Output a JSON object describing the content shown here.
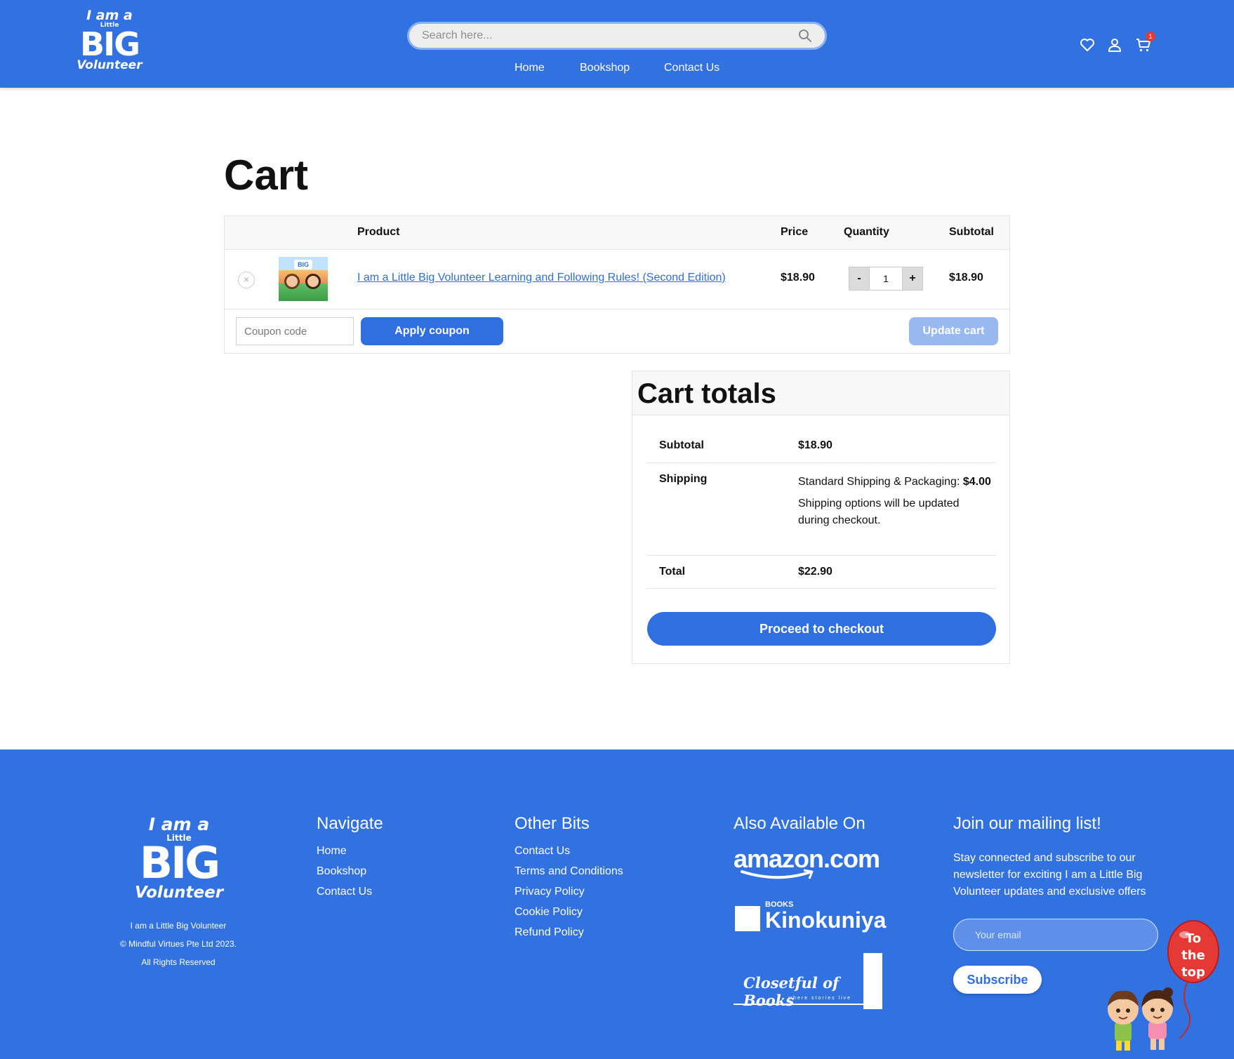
{
  "header": {
    "logo": {
      "line1": "I am a",
      "line2": "Little",
      "line3": "BIG",
      "line4": "Volunteer"
    },
    "search_placeholder": "Search here...",
    "nav": [
      "Home",
      "Bookshop",
      "Contact Us"
    ],
    "cart_count": "1",
    "icons": [
      "heart-icon",
      "user-icon",
      "cart-icon"
    ]
  },
  "cart": {
    "title": "Cart",
    "columns": [
      "Product",
      "Price",
      "Quantity",
      "Subtotal"
    ],
    "item": {
      "remove": "×",
      "name": "I am a Little Big Volunteer Learning and Following Rules! (Second Edition)",
      "thumb_label": "BIG",
      "price": "$18.90",
      "quantity": "1",
      "minus": "-",
      "plus": "+",
      "subtotal": "$18.90"
    },
    "coupon_placeholder": "Coupon code",
    "apply_label": "Apply coupon",
    "update_label": "Update cart"
  },
  "totals": {
    "title": "Cart totals",
    "subtotal_label": "Subtotal",
    "subtotal_value": "$18.90",
    "shipping_label": "Shipping",
    "shipping_method": "Standard Shipping & Packaging:",
    "shipping_cost": "$4.00",
    "shipping_note_1": "Shipping options will be updated",
    "shipping_note_2": "during checkout.",
    "total_label": "Total",
    "total_value": "$22.90",
    "checkout_label": "Proceed to checkout"
  },
  "footer": {
    "logo": {
      "line1": "I am a",
      "line2": "Little",
      "line3": "BIG",
      "line4": "Volunteer"
    },
    "brand": "I am a Little Big Volunteer",
    "copyright": "© Mindful Virtues Pte Ltd 2023.",
    "rights": "All Rights Reserved",
    "navigate_title": "Navigate",
    "navigate_links": [
      "Home",
      "Bookshop",
      "Contact Us"
    ],
    "other_title": "Other Bits",
    "other_links": [
      "Contact Us",
      "Terms and Conditions",
      "Privacy Policy",
      "Cookie Policy",
      "Refund Policy"
    ],
    "available_title": "Also Available On",
    "stores": {
      "amazon": "amazon.com",
      "kino_small": "BOOKS",
      "kino": "Kinokuniya",
      "closet": "Closetful of Books",
      "closet_tag": "where stories live"
    },
    "mailing_title": "Join our mailing list!",
    "mailing_text": "Stay connected and subscribe to our newsletter for exciting I am a Little Big Volunteer updates and exclusive offers",
    "email_placeholder": "Your email",
    "subscribe_label": "Subscribe",
    "to_top": [
      "To",
      "the",
      "top"
    ]
  },
  "colors": {
    "brand_blue": "#3171e0",
    "button_blue": "#2f6fe0",
    "disabled_blue": "#98b9f0",
    "link_blue": "#2d6fd6",
    "badge_red": "#e53935"
  }
}
